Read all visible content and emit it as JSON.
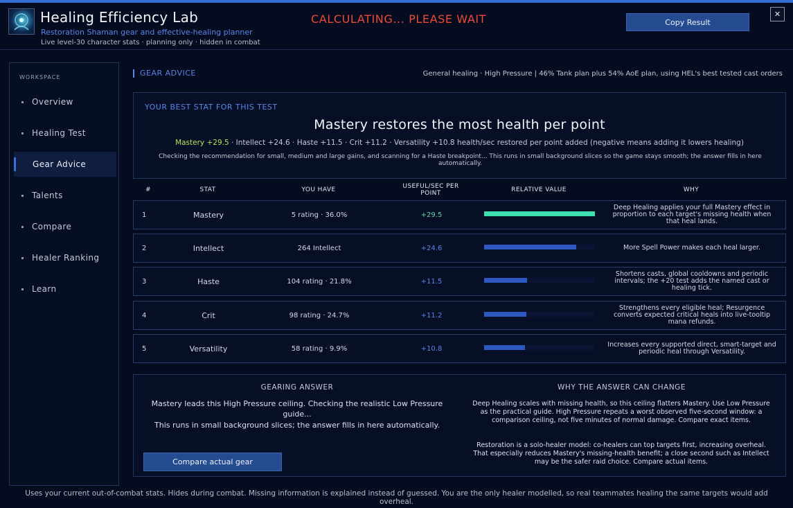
{
  "header": {
    "title": "Healing Efficiency Lab",
    "subtitle": "Restoration Shaman gear and effective-healing planner",
    "meta": "Live level-30 character stats  ·  planning only  ·  hidden in combat",
    "status": "CALCULATING... PLEASE WAIT",
    "copy_label": "Copy Result",
    "close_label": "✕",
    "icon": "shaman-portrait-icon"
  },
  "sidebar": {
    "heading": "WORKSPACE",
    "items": [
      {
        "label": "Overview",
        "active": false
      },
      {
        "label": "Healing Test",
        "active": false
      },
      {
        "label": "Gear Advice",
        "active": true
      },
      {
        "label": "Talents",
        "active": false
      },
      {
        "label": "Compare",
        "active": false
      },
      {
        "label": "Healer Ranking",
        "active": false
      },
      {
        "label": "Learn",
        "active": false
      }
    ]
  },
  "main": {
    "section_label": "GEAR ADVICE",
    "context": "General healing · High Pressure   |   46% Tank plan plus 54% AoE plan, using HEL's best tested cast orders",
    "best": {
      "label": "YOUR BEST STAT FOR THIS TEST",
      "headline": "Mastery restores the most health per point",
      "top_score": "Mastery +29.5",
      "other_scores": "  ·  Intellect +24.6  ·  Haste +11.5  ·  Crit +11.2  ·  Versatility +10.8     health/sec restored per point added (negative means adding it lowers healing)",
      "note": "Checking the recommendation for small, medium and large gains, and scanning for a Haste breakpoint... This runs in small background slices so the game stays smooth; the answer fills in here automatically."
    },
    "table": {
      "headers": {
        "num": "#",
        "stat": "STAT",
        "have": "YOU HAVE",
        "value": "USEFUL/SEC PER POINT",
        "relative": "RELATIVE VALUE",
        "why": "WHY"
      },
      "rows": [
        {
          "num": "1",
          "stat": "Mastery",
          "have": "5 rating · 36.0%",
          "value": "+29.5",
          "relative": 1.0,
          "why": "Deep Healing applies your full Mastery effect in proportion to each target's missing health when that heal lands."
        },
        {
          "num": "2",
          "stat": "Intellect",
          "have": "264 Intellect",
          "value": "+24.6",
          "relative": 0.834,
          "why": "More Spell Power makes each heal larger."
        },
        {
          "num": "3",
          "stat": "Haste",
          "have": "104 rating · 21.8%",
          "value": "+11.5",
          "relative": 0.39,
          "why": "Shortens casts, global cooldowns and periodic intervals; the +20 test adds the named cast or healing tick."
        },
        {
          "num": "4",
          "stat": "Crit",
          "have": "98 rating · 24.7%",
          "value": "+11.2",
          "relative": 0.38,
          "why": "Strengthens every eligible heal; Resurgence converts expected critical heals into live-tooltip mana refunds."
        },
        {
          "num": "5",
          "stat": "Versatility",
          "have": "58 rating · 9.9%",
          "value": "+10.8",
          "relative": 0.366,
          "why": "Increases every supported direct, smart-target and periodic heal through Versatility."
        }
      ]
    },
    "gearing": {
      "title": "GEARING ANSWER",
      "text1": "Mastery leads this High Pressure ceiling. Checking the realistic Low Pressure guide...",
      "text2": "This runs in small background slices; the answer fills in here automatically.",
      "compare_label": "Compare actual gear"
    },
    "why_change": {
      "title": "WHY THE ANSWER CAN CHANGE",
      "para1": "Deep Healing scales with missing health, so this ceiling flatters Mastery. Use Low Pressure as the practical guide. High Pressure repeats a worst observed five-second window: a comparison ceiling, not five minutes of normal damage. Compare exact items.",
      "para2": "Restoration is a solo-healer model: co-healers can top targets first, increasing overheal. That especially reduces Mastery's missing-health benefit; a close second such as Intellect may be the safer raid choice. Compare actual items."
    }
  },
  "footer": "Uses your current out-of-combat stats. Hides during combat. Missing information is explained instead of guessed. You are the only healer modelled, so real teammates healing the same targets would add overheal.",
  "colors": {
    "accent": "#5b86e6",
    "status": "#ee4a36",
    "top_stat": "#b7e15a",
    "top_bar": "#3fe0b0",
    "bar": "#2e58c2"
  }
}
